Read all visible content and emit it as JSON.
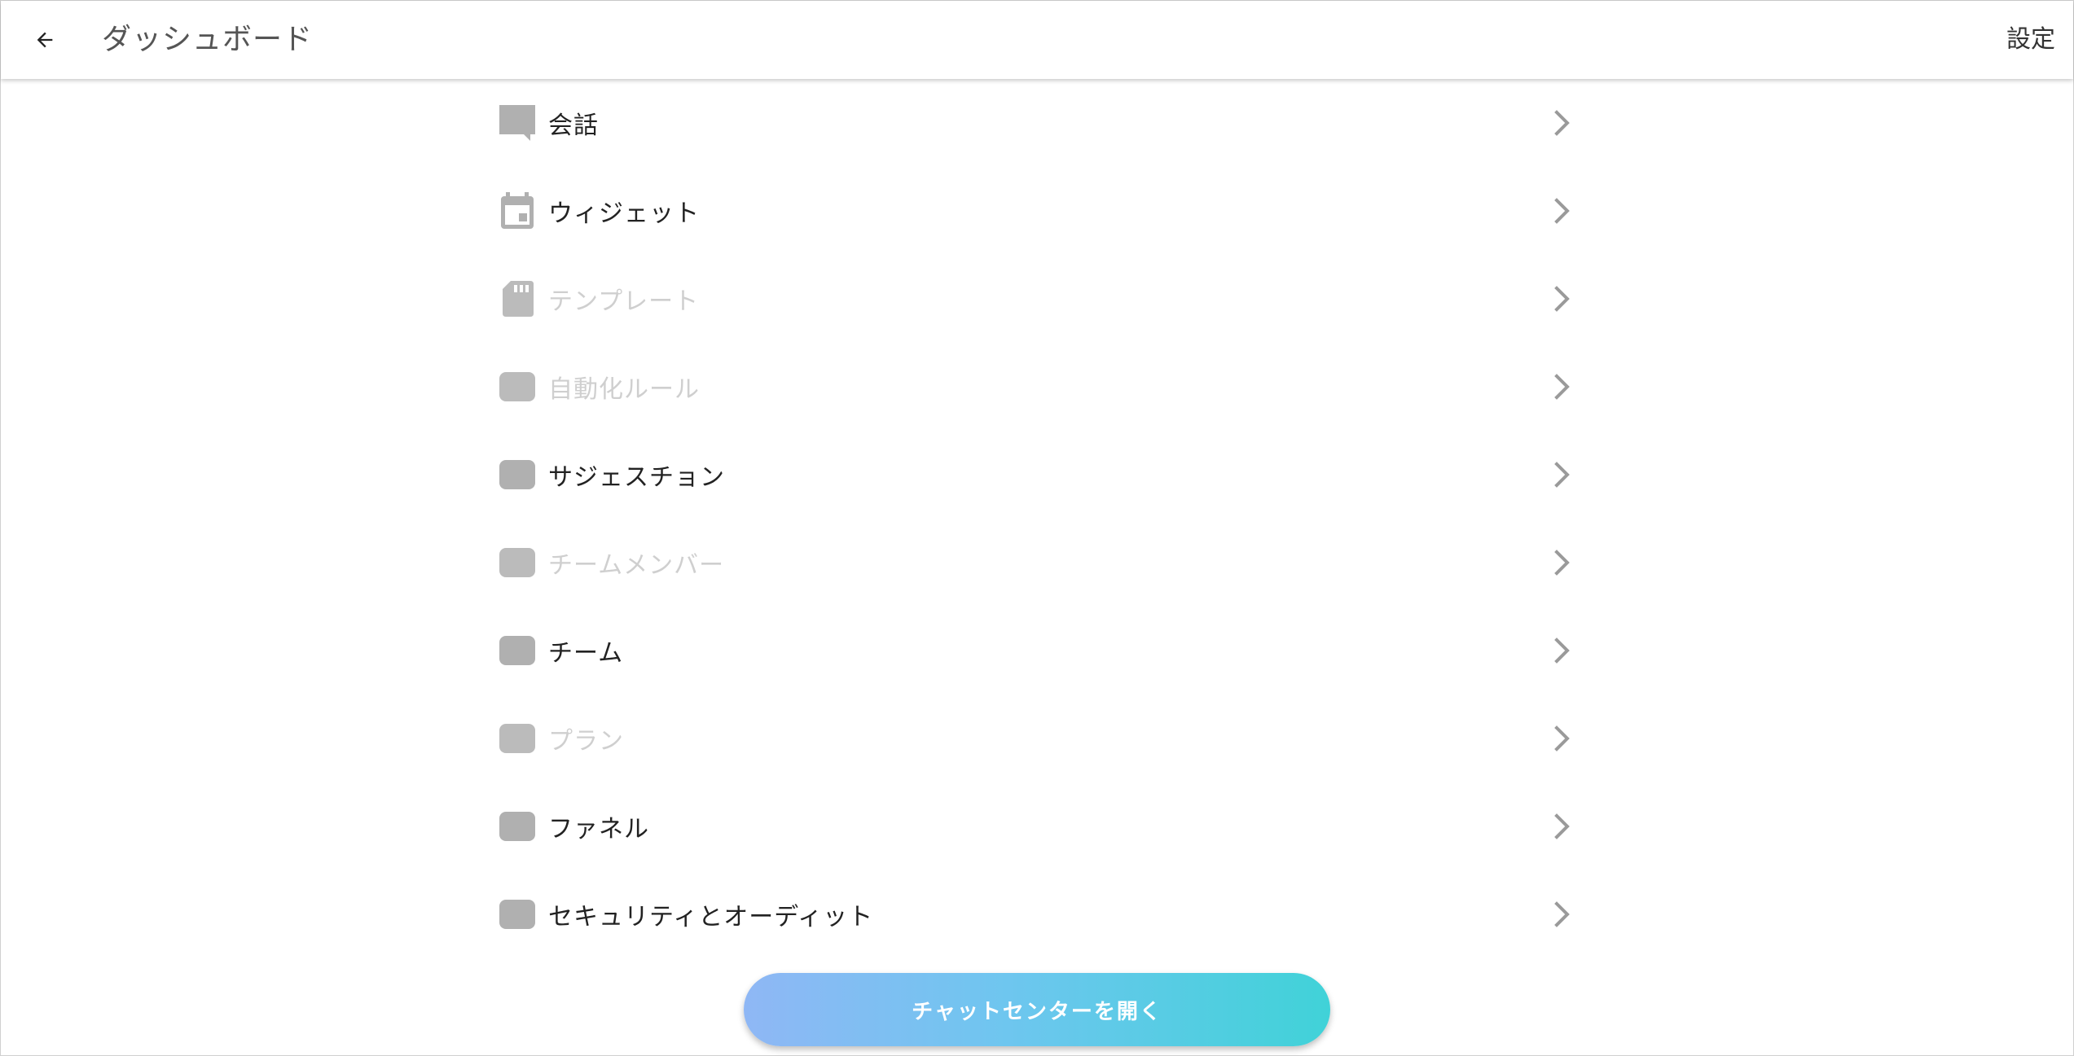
{
  "header": {
    "title": "ダッシュボード",
    "settings_label": "設定",
    "back_icon": "arrow-left-icon"
  },
  "menu": {
    "items": [
      {
        "label": "会話",
        "icon": "chat-bubble-icon",
        "enabled": true
      },
      {
        "label": "ウィジェット",
        "icon": "calendar-icon",
        "enabled": true
      },
      {
        "label": "テンプレート",
        "icon": "sd-card-icon",
        "enabled": false
      },
      {
        "label": "自動化ルール",
        "icon": "placeholder-icon",
        "enabled": false
      },
      {
        "label": "サジェスチョン",
        "icon": "placeholder-icon",
        "enabled": true
      },
      {
        "label": "チームメンバー",
        "icon": "placeholder-icon",
        "enabled": false
      },
      {
        "label": "チーム",
        "icon": "placeholder-icon",
        "enabled": true
      },
      {
        "label": "プラン",
        "icon": "placeholder-icon",
        "enabled": false
      },
      {
        "label": "ファネル",
        "icon": "placeholder-icon",
        "enabled": true
      },
      {
        "label": "セキュリティとオーディット",
        "icon": "placeholder-icon",
        "enabled": true
      }
    ]
  },
  "footer": {
    "cta_label": "チャットセンターを開く"
  },
  "colors": {
    "icon_gray": "#b0b0b0",
    "text_enabled": "#222222",
    "text_disabled": "#cfcfcf",
    "chevron": "#9a9a9a",
    "cta_gradient_start": "#8fb7f5",
    "cta_gradient_end": "#40d2d8"
  }
}
